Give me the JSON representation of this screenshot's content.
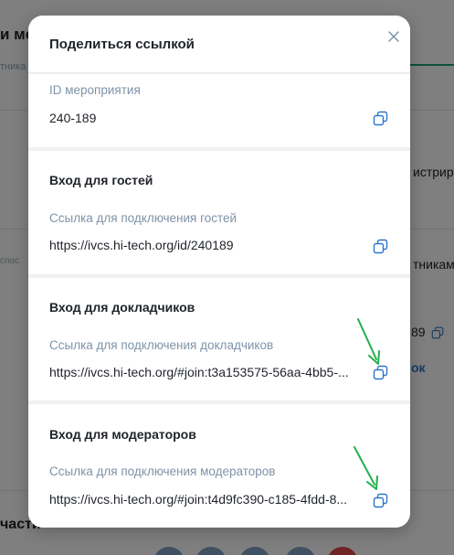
{
  "background": {
    "heading_fragment": "и ме",
    "subtitle_fragment": "тника",
    "register_fragment": "истриру",
    "muted_fragment": "спос",
    "participants_fragment": "тникам",
    "id_fragment": "89",
    "link_fragment": "ок",
    "section_fragment": "части"
  },
  "modal": {
    "title": "Поделиться ссылкой",
    "close_icon": "close-icon",
    "event_id": {
      "label": "ID мероприятия",
      "value": "240-189"
    },
    "sections": [
      {
        "title": "Вход для гостей",
        "label": "Ссылка для подключения гостей",
        "value": "https://ivcs.hi-tech.org/id/240189"
      },
      {
        "title": "Вход для докладчиков",
        "label": "Ссылка для подключения докладчиков",
        "value": "https://ivcs.hi-tech.org/#join:t3a153575-56aa-4bb5-..."
      },
      {
        "title": "Вход для модераторов",
        "label": "Ссылка для подключения модераторов",
        "value": "https://ivcs.hi-tech.org/#join:t4d9fc390-c185-4fdd-8..."
      }
    ],
    "copy_icon": "copy-icon"
  },
  "colors": {
    "accent": "#2e77c8",
    "label": "#7e93a8",
    "arrow": "#22b04b"
  }
}
